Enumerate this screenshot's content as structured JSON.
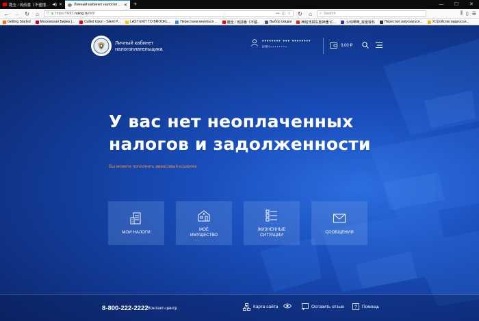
{
  "browser": {
    "tabs": [
      {
        "title": "趣全 / 琉詩番《不儘懂世》",
        "favicon_color": "#ff0000",
        "active": false
      },
      {
        "title": "Личный кабинет налогоплате...",
        "favicon_color": "#8a8a8a",
        "active": true
      }
    ],
    "url_prefix": "https://lkfl2.",
    "url_domain": "nalog.ru",
    "url_suffix": "/lkfl/",
    "search_placeholder": "Search"
  },
  "bookmarks": [
    {
      "label": "Getting Started",
      "color": "#ff6a00"
    },
    {
      "label": "Московская Биржа |...",
      "color": "#d0021b"
    },
    {
      "label": "Called Upon - Silent P...",
      "color": "#ff0000"
    },
    {
      "label": "LAST EXIT TO BROOKL...",
      "color": "#f5c518"
    },
    {
      "label": "Перестаем меняться ...",
      "color": "#4285f4"
    },
    {
      "label": "趣全 / 琉詩番《不儘...",
      "color": "#ff0000"
    },
    {
      "label": "Выбор скидки",
      "color": "#3b5998"
    },
    {
      "label": "西班牙拼车嘉神器 (C...",
      "color": "#e1251b"
    },
    {
      "label": "小鸡呷呷_百度百科",
      "color": "#2932e1"
    },
    {
      "label": "Перестал запускаться...",
      "color": "#333333"
    },
    {
      "label": "Устройство видеосъе...",
      "color": "#f2b705"
    }
  ],
  "header": {
    "brand_line1": "Личный кабинет",
    "brand_line2": "налогоплательщика",
    "user_name": "•••••••• ••• ••••••••",
    "user_inn": "ИНН • • • • • • • •",
    "balance": "0.00 ₽"
  },
  "main": {
    "headline_line1": "У вас нет неоплаченных",
    "headline_line2": "налогов и задолженности",
    "subtext": "Вы можете пополнить авансовый кошелек"
  },
  "tiles": [
    {
      "label": "МОИ НАЛОГИ",
      "icon": "taxes-icon"
    },
    {
      "label": "МОЁ ИМУЩЕСТВО",
      "label_line1": "МОЁ",
      "label_line2": "ИМУЩЕСТВО",
      "icon": "property-icon"
    },
    {
      "label": "ЖИЗНЕННЫЕ СИТУАЦИИ",
      "label_line1": "ЖИЗНЕННЫЕ",
      "label_line2": "СИТУАЦИИ",
      "icon": "life-situations-icon"
    },
    {
      "label": "СООБЩЕНИЯ",
      "icon": "messages-icon"
    }
  ],
  "footer": {
    "phone": "8-800-222-2222",
    "contact_label": "Контакт-центр",
    "sitemap_label": "Карта сайта",
    "feedback_label": "Оставить отзыв",
    "help_label": "Помощь"
  }
}
